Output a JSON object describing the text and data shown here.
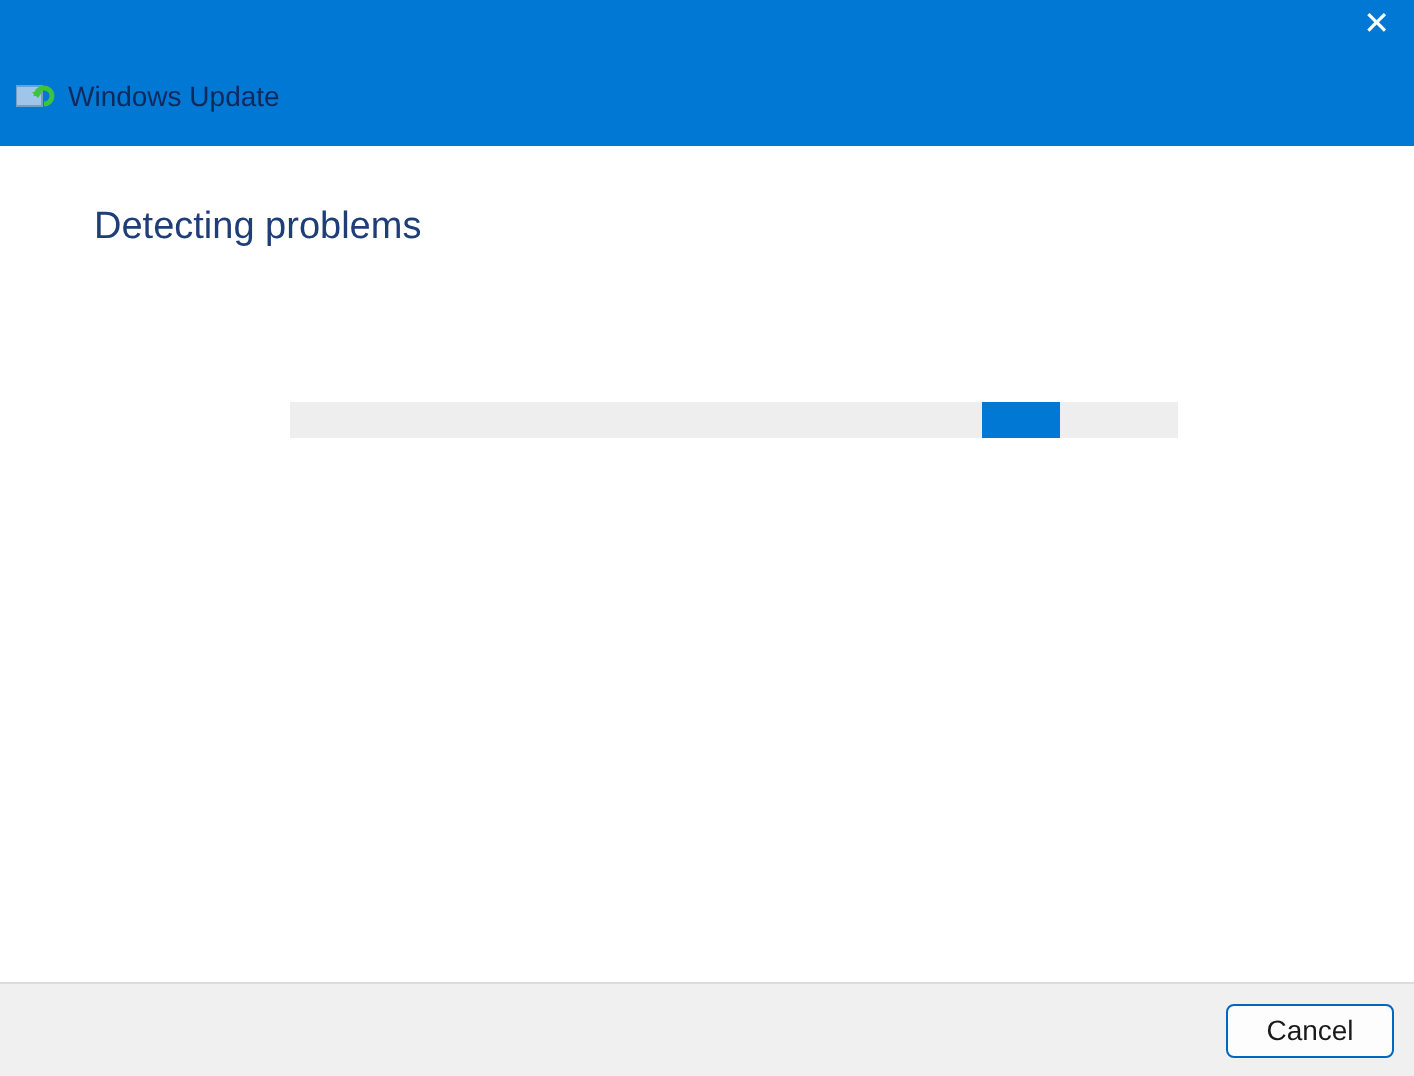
{
  "window": {
    "title": "Windows Update",
    "close": "✕"
  },
  "heading": "Detecting problems",
  "progress": {
    "indeterminate": true
  },
  "buttons": [
    {
      "label": "Cancel",
      "kind": "default"
    }
  ]
}
